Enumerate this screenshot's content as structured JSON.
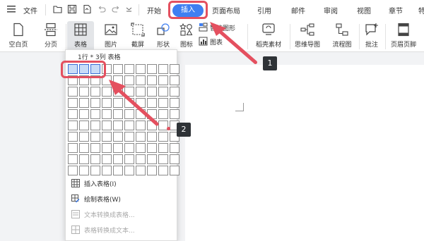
{
  "menubar": {
    "file_label": "文件",
    "tabs": [
      "开始",
      "插入",
      "页面布局",
      "引用",
      "邮件",
      "审阅",
      "视图",
      "章节",
      "特"
    ],
    "active_tab": "插入"
  },
  "ribbon": {
    "blank_page": "空白页",
    "page_break": "分页",
    "table": "表格",
    "picture": "图片",
    "screenshot": "截屏",
    "shape": "形状",
    "icon": "图标",
    "smart_graphic": "智能图形",
    "chart": "图表",
    "stock_material": "稻壳素材",
    "mind_map": "思维导图",
    "flowchart": "流程图",
    "comment": "批注",
    "header_footer": "页眉页脚"
  },
  "table_dropdown": {
    "size_label": "1行 * 3列 表格",
    "rows": 10,
    "cols": 10,
    "selected_rows": 1,
    "selected_cols": 3,
    "items": [
      {
        "label": "插入表格(I)",
        "icon": "insert-table-icon",
        "enabled": true
      },
      {
        "label": "绘制表格(W)",
        "icon": "draw-table-icon",
        "enabled": true
      },
      {
        "label": "文本转换成表格...",
        "icon": "text-to-table-icon",
        "enabled": false
      },
      {
        "label": "表格转换成文本...",
        "icon": "table-to-text-icon",
        "enabled": false
      }
    ]
  },
  "annotations": {
    "step1": "1",
    "step2": "2",
    "color": "#e4505f"
  },
  "colors": {
    "accent": "#3f7ff1",
    "highlight": "#e4505f",
    "badge": "#2f3337"
  }
}
